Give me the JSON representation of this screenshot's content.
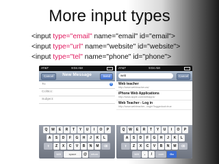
{
  "slide": {
    "title": "More input types",
    "lines": [
      [
        {
          "text": "<input ",
          "highlight": false
        },
        {
          "text": "type=\"email\"",
          "highlight": true
        },
        {
          "text": " name=\"email\" id=\"email\">",
          "highlight": false
        }
      ],
      [
        {
          "text": "<input ",
          "highlight": false
        },
        {
          "text": "type=\"url\"",
          "highlight": true
        },
        {
          "text": " name=\"website\" id=\"website\">",
          "highlight": false
        }
      ],
      [
        {
          "text": "<input ",
          "highlight": false
        },
        {
          "text": "type=\"tel\"",
          "highlight": true
        },
        {
          "text": " name=\"phone\" id=\"phone\">",
          "highlight": false
        }
      ]
    ]
  },
  "phone_left": {
    "status": {
      "carrier": "AT&T",
      "time": "9:04 AM"
    },
    "nav": {
      "cancel": "Cancel",
      "title": "New Message",
      "send": "Send"
    },
    "fields": {
      "to": "To:",
      "cc": "Cc/Bcc:",
      "subject": "Subject:"
    },
    "keyboard": {
      "row1": [
        "Q",
        "W",
        "E",
        "R",
        "T",
        "Y",
        "U",
        "I",
        "O",
        "P"
      ],
      "row2": [
        "A",
        "S",
        "D",
        "F",
        "G",
        "H",
        "J",
        "K",
        "L"
      ],
      "row3": [
        "Z",
        "X",
        "C",
        "V",
        "B",
        "N",
        "M"
      ],
      "numbers_key": "123",
      "space_key": "space",
      "at_key": "@",
      "return_key": "return"
    }
  },
  "phone_right": {
    "status": {
      "carrier": "AT&T",
      "time": "9:04 AM"
    },
    "search": {
      "value": "web",
      "cancel": "Cancel"
    },
    "results": [
      {
        "title": "Web teacher",
        "url": "http://www.webteacher.ws/"
      },
      {
        "title": "iPhone Web Applications",
        "url": "http://www.apple.com/webapps/"
      },
      {
        "title": "Web Teacher - Log in",
        "url": "http://www.webteacher.../login?loggedout=true"
      }
    ],
    "keyboard": {
      "row1": [
        "Q",
        "W",
        "E",
        "R",
        "T",
        "Y",
        "U",
        "I",
        "O",
        "P"
      ],
      "row2": [
        "A",
        "S",
        "D",
        "F",
        "G",
        "H",
        "J",
        "K",
        "L"
      ],
      "row3": [
        "Z",
        "X",
        "C",
        "V",
        "B",
        "N",
        "M"
      ],
      "numbers_key": "123",
      "dot_key": ".",
      "slash_key": "/",
      "dotcom_key": ".com",
      "go_key": "Go"
    }
  },
  "colors": {
    "highlight": "#e0185e",
    "ios_nav": "#8899b0",
    "go_key": "#3a6cd4"
  },
  "icons": [
    "add-contact-icon",
    "battery-icon"
  ]
}
